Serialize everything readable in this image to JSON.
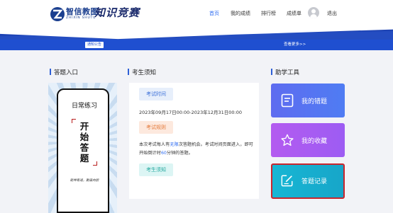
{
  "header": {
    "logo_cn": "智信教图",
    "logo_en": "ZHIXIN SHUTU",
    "brand_title": "知识竞赛",
    "nav": {
      "home": "首页",
      "my_scores": "我的成绩",
      "ranking": "排行榜",
      "score_report": "成绩单",
      "logout": "退出"
    }
  },
  "notice_bar": {
    "tag": "通知公告",
    "more": "查看更多>>"
  },
  "sections": {
    "entry": "答题入口",
    "notice": "考生须知",
    "tools": "助学工具"
  },
  "practice": {
    "title": "日常练习",
    "start_chars": [
      "开",
      "始",
      "答",
      "题"
    ],
    "motto": "乾坤有道，勤奋向前"
  },
  "notice": {
    "time_label": "考试时间",
    "time_value": "2023年09月17日00:00-2023年12月31日00:00",
    "rules_label": "考试规则",
    "rules_part1": "本次考试每人有",
    "rules_highlight1": "无限",
    "rules_part2": "次答题机会。考试时间页面进入，即可开始倒计时",
    "rules_highlight2": "60",
    "rules_part3": "分钟的答题。",
    "notes_label": "考生须知"
  },
  "tools": {
    "wrong": "我的错题",
    "favorites": "我的收藏",
    "records": "答题记录"
  },
  "colors": {
    "accent": "#2e6cf2",
    "banner": "#1f4fd0",
    "tool_wrong": "#5670f0",
    "tool_fav": "#a95bf0",
    "tool_record": "#17b0cf",
    "highlight_border": "#c9262d"
  },
  "icons": {
    "avatar": "user-avatar-icon",
    "wrong": "document-icon",
    "favorites": "star-icon",
    "records": "edit-icon"
  }
}
